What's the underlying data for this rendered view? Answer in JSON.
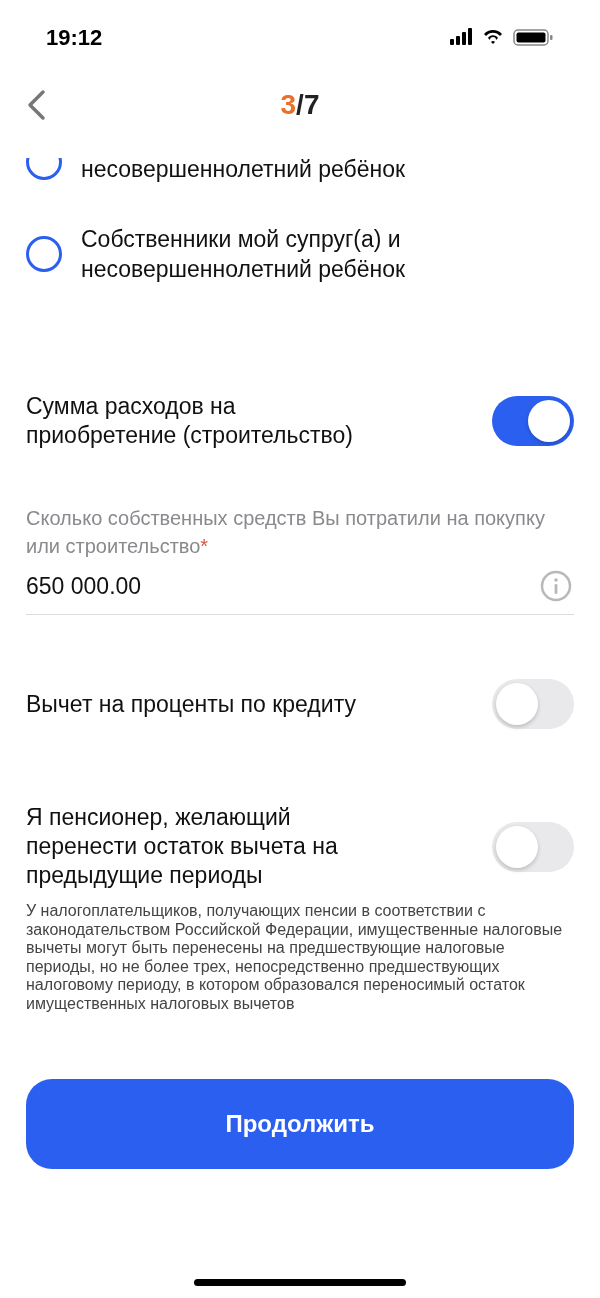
{
  "status_bar": {
    "time": "19:12"
  },
  "header": {
    "step_current": "3",
    "step_total": "/7"
  },
  "options": [
    {
      "label": "несовершеннолетний ребёнок",
      "selected": false,
      "cut": true
    },
    {
      "label": "Собственники мой супруг(а) и несовершеннолетний ребёнок",
      "selected": false,
      "cut": false
    }
  ],
  "sections": [
    {
      "kind": "toggle",
      "label": "Сумма расходов на приобретение (строительство)",
      "on": true
    },
    {
      "kind": "field",
      "label": "Сколько собственных средств Вы потратили на покупку или строительство",
      "required_mark": "*",
      "value": "650 000.00"
    },
    {
      "kind": "toggle",
      "label": "Вычет на проценты по кредиту",
      "on": false
    },
    {
      "kind": "toggle",
      "label": "Я пенсионер, желающий перенести остаток вычета на предыдущие периоды",
      "on": false,
      "note": "У налогоплательщиков, получающих пенсии в соответствии с законодательством Российской Федерации, имущественные налоговые вычеты могут быть перенесены на предшествующие налоговые периоды, но не более трех, непосредственно предшествующих налоговому периоду, в котором образовался переносимый остаток имущественных налоговых вычетов"
    }
  ],
  "continue_button": "Продолжить"
}
